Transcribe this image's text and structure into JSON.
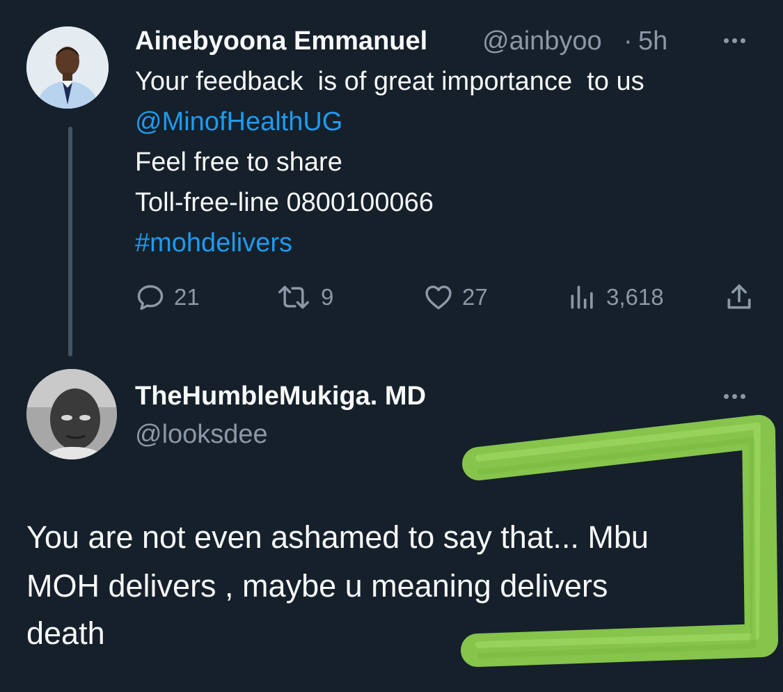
{
  "thread": {
    "tweet": {
      "author_name": "Ainebyoona Emmanuel",
      "author_handle": "@ainbyoo",
      "separator": "·",
      "time": "5h",
      "text_lines": [
        {
          "text": "Your feedback  is of great importance  to us",
          "link": false
        },
        {
          "text": "@MinofHealthUG",
          "link": true
        },
        {
          "text": "Feel free to share",
          "link": false
        },
        {
          "text": "Toll-free-line 0800100066",
          "link": false
        },
        {
          "text": "#mohdelivers",
          "link": true
        }
      ],
      "actions": {
        "replies": "21",
        "retweets": "9",
        "likes": "27",
        "views": "3,618"
      }
    },
    "reply": {
      "author_name": "TheHumbleMukiga. MD",
      "author_handle": "@looksdee",
      "text_lines": [
        "You are not even ashamed to say that... Mbu",
        "MOH delivers , maybe u meaning delivers",
        "death"
      ]
    }
  },
  "icons": {
    "reply": "speech-bubble-icon",
    "retweet": "retweet-icon",
    "like": "heart-icon",
    "views": "bar-chart-icon",
    "share": "share-icon",
    "more": "more-dots-icon"
  },
  "colors": {
    "background": "#15202b",
    "text": "#f7f9f9",
    "muted": "#8b98a5",
    "link": "#1d9bf0",
    "highlight_mark": "#8fd14f"
  }
}
